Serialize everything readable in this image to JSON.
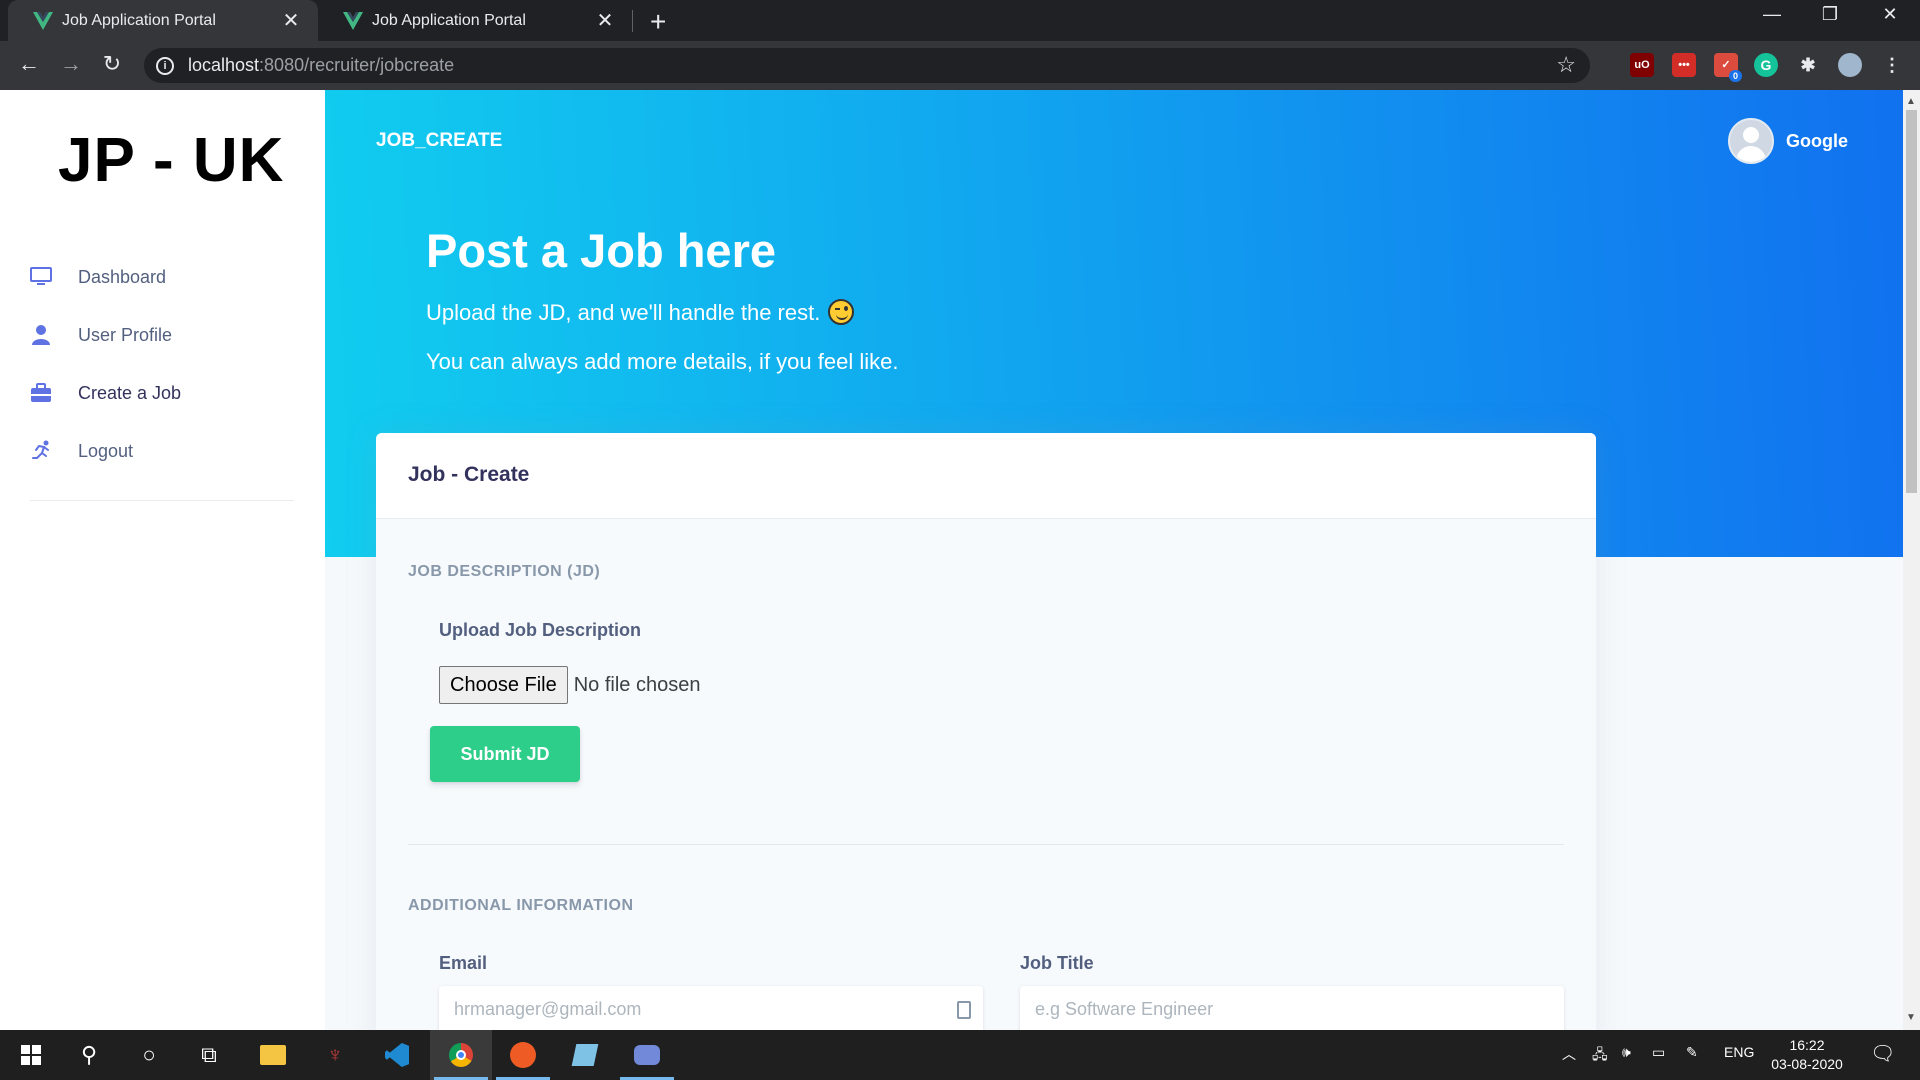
{
  "browser": {
    "tabs": [
      {
        "title": "Job Application Portal",
        "active": true
      },
      {
        "title": "Job Application Portal",
        "active": false
      }
    ],
    "url_host": "localhost",
    "url_path": ":8080/recruiter/jobcreate",
    "window_controls": [
      "minimize-icon",
      "restore-icon",
      "close-icon"
    ],
    "extensions": [
      "ublock-icon",
      "lastpass-icon",
      "todoist-icon",
      "grammarly-icon",
      "puzzle-icon",
      "profile-icon"
    ],
    "todoist_badge": "0"
  },
  "sidebar": {
    "brand": "JP - UK",
    "items": [
      {
        "label": "Dashboard",
        "icon": "monitor-icon",
        "color": "#5e72e4"
      },
      {
        "label": "User Profile",
        "icon": "user-icon",
        "color": "#5e72e4"
      },
      {
        "label": "Create a Job",
        "icon": "briefcase-icon",
        "color": "#5e72e4"
      },
      {
        "label": "Logout",
        "icon": "running-icon",
        "color": "#5e72e4"
      }
    ]
  },
  "header": {
    "breadcrumb": "JOB_CREATE",
    "user_name": "Google",
    "title": "Post a Job here",
    "line1": "Upload the JD, and we'll handle the rest.",
    "line2": "You can always add more details, if you feel like.",
    "gradient": [
      "#11cdef",
      "#1171ef"
    ]
  },
  "card": {
    "title": "Job - Create",
    "jd_section": "JOB DESCRIPTION (JD)",
    "upload_label": "Upload Job Description",
    "file_button": "Choose File",
    "file_status": "No file chosen",
    "submit_label": "Submit JD",
    "additional_section": "ADDITIONAL INFORMATION",
    "email_label": "Email",
    "email_placeholder": "hrmanager@gmail.com",
    "title_label": "Job Title",
    "title_placeholder": "e.g Software Engineer",
    "submit_color": "#2dce89"
  },
  "taskbar": {
    "lang": "ENG",
    "time": "16:22",
    "date": "03-08-2020"
  }
}
